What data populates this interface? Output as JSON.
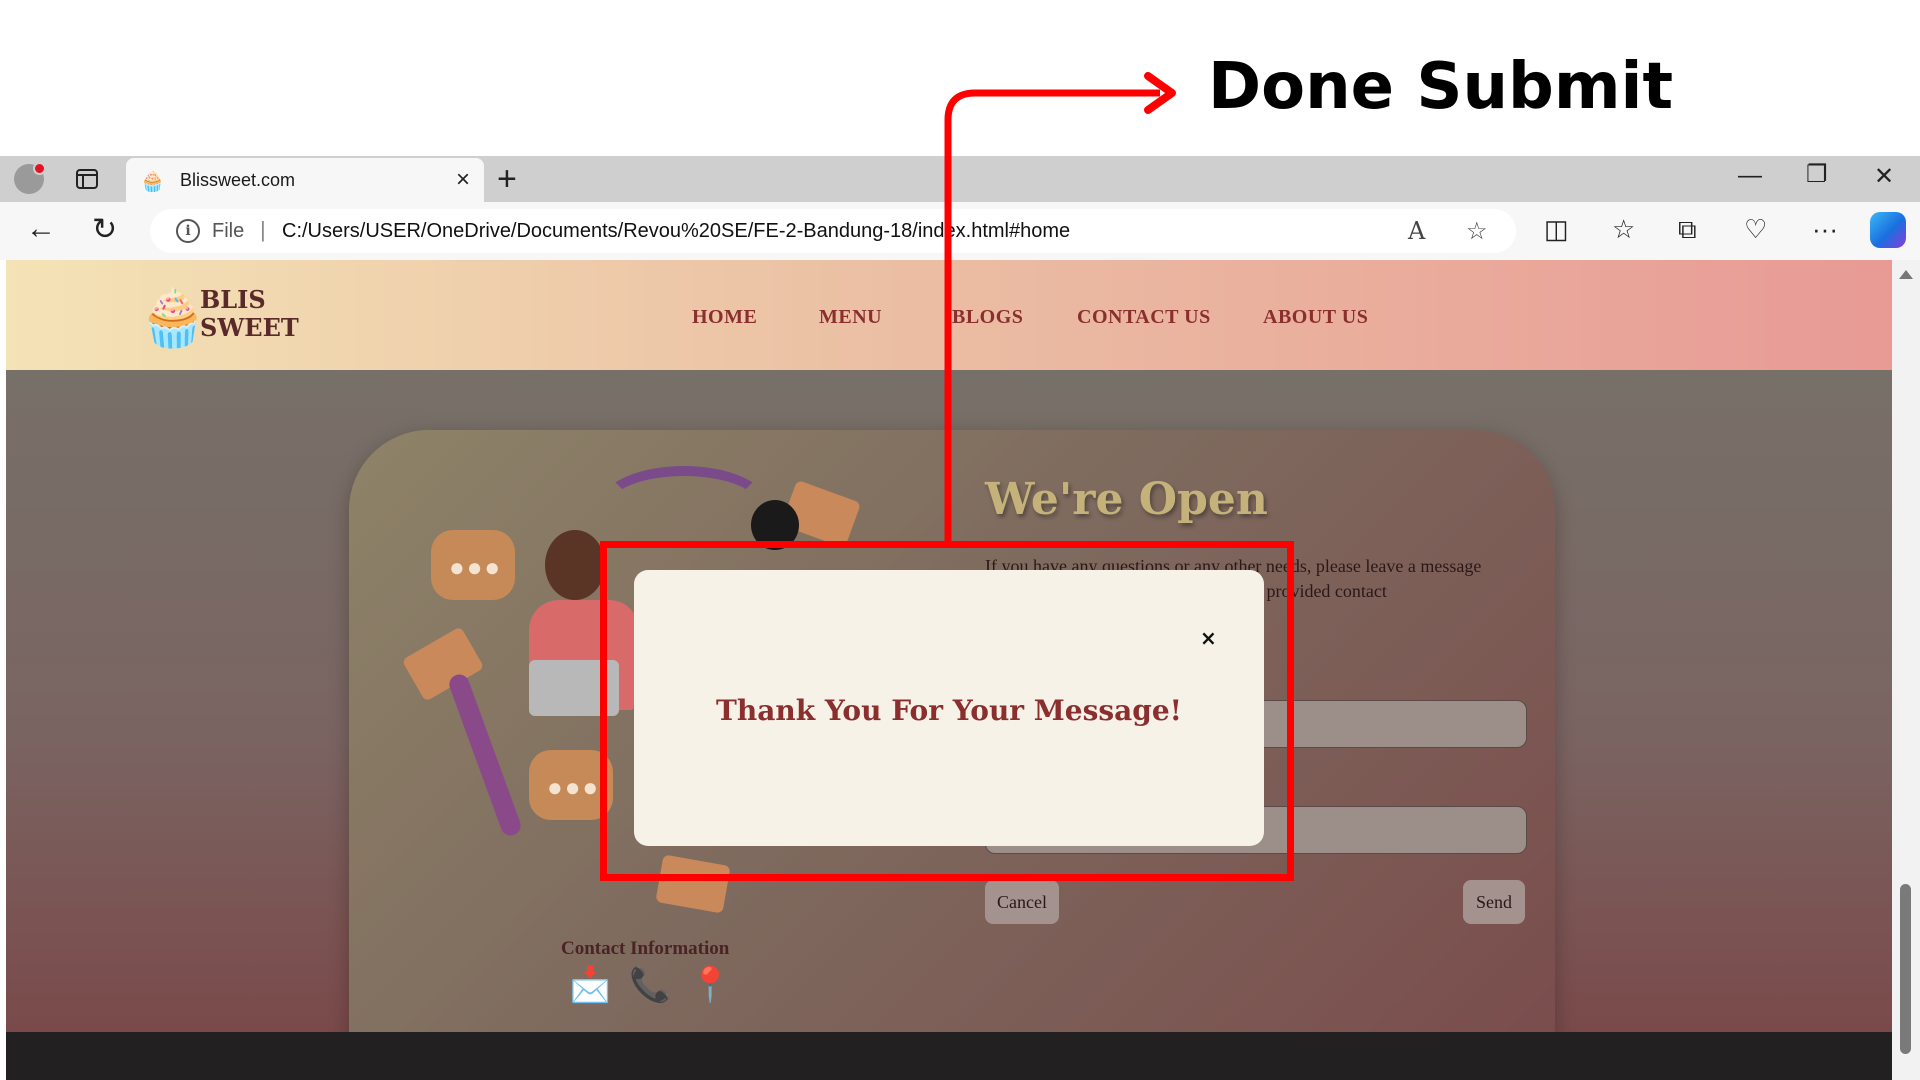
{
  "annotation": {
    "label": "Done Submit",
    "color": "#ff0000"
  },
  "browser": {
    "tab_title": "Blissweet.com",
    "new_tab_label": "+",
    "address": {
      "scheme_label": "File",
      "url": "C:/Users/USER/OneDrive/Documents/Revou%20SE/FE-2-Bandung-18/index.html#home"
    }
  },
  "site": {
    "logo": {
      "line1": "BLIS",
      "line2": "SWEET"
    },
    "nav": [
      "HOME",
      "MENU",
      "BLOGS",
      "CONTACT US",
      "ABOUT US"
    ],
    "contact": {
      "title": "We're Open",
      "description": "If you have any questions or any other needs, please leave a message through the form below or through the provided contact",
      "buttons": {
        "cancel": "Cancel",
        "send": "Send"
      },
      "info_title": "Contact Information",
      "info_icons": [
        "email-icon",
        "whatsapp-icon",
        "location-pin-icon"
      ]
    },
    "colors": {
      "header_start": "#f4e3b6",
      "header_end": "#e89a95",
      "accent": "#8a2e2e"
    }
  },
  "modal": {
    "message": "Thank You For Your Message!",
    "close_label": "×"
  }
}
